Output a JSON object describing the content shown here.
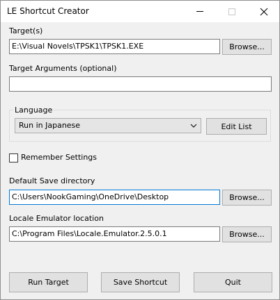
{
  "window": {
    "title": "LE Shortcut Creator"
  },
  "target": {
    "label": "Target(s)",
    "value": "E:\\Visual Novels\\TPSK1\\TPSK1.EXE",
    "browse_label": "Browse..."
  },
  "arguments": {
    "label": "Target Arguments (optional)",
    "value": ""
  },
  "language": {
    "group_label": "Language",
    "selected": "Run in Japanese",
    "edit_list_label": "Edit List"
  },
  "remember": {
    "label": "Remember Settings",
    "checked": false
  },
  "save_directory": {
    "label": "Default Save directory",
    "value": "C:\\Users\\NookGaming\\OneDrive\\Desktop",
    "browse_label": "Browse..."
  },
  "locale_emulator": {
    "label": "Locale Emulator location",
    "value": "C:\\Program Files\\Locale.Emulator.2.5.0.1",
    "browse_label": "Browse..."
  },
  "actions": {
    "run_target": "Run Target",
    "save_shortcut": "Save Shortcut",
    "quit": "Quit"
  },
  "colors": {
    "window_background": "#f0f0f0",
    "focus_border": "#0078d7",
    "button_background": "#e1e1e1"
  }
}
